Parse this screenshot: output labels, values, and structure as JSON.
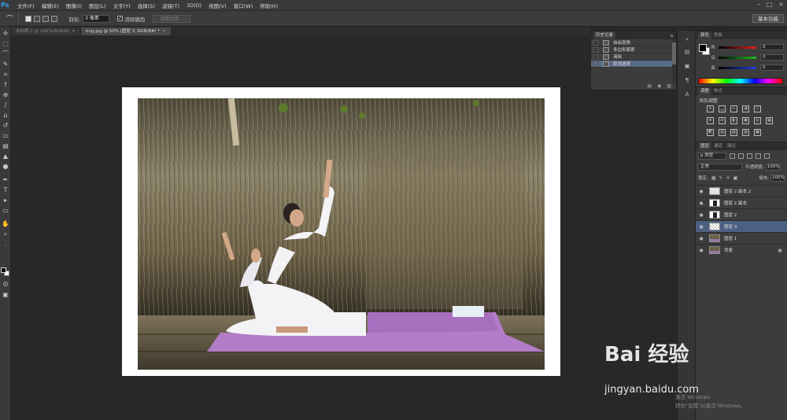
{
  "app": {
    "logo": "Ps"
  },
  "menu": [
    "文件(F)",
    "编辑(E)",
    "图像(I)",
    "图层(L)",
    "文字(Y)",
    "选择(S)",
    "滤镜(T)",
    "3D(D)",
    "视图(V)",
    "窗口(W)",
    "帮助(H)"
  ],
  "window_controls": [
    "–",
    "□",
    "×"
  ],
  "options": {
    "tool_icon": "lasso-icon",
    "feather_label": "羽化:",
    "feather_value": "0 像素",
    "antialias_label": "消除锯齿",
    "antialias_checked": true,
    "refine_edge": "调整边缘...",
    "workspace": "基本功能"
  },
  "tabs": [
    {
      "label": "未标题-1 @ 100%(RGB/8)",
      "active": false
    },
    {
      "label": "ting.jpg @ 50% (图层 3, RGB/8#) *",
      "active": true
    }
  ],
  "history": {
    "tabs": [
      "历史记录"
    ],
    "menu": "≡",
    "items": [
      {
        "label": "自由变换",
        "selected": false
      },
      {
        "label": "多边形套索",
        "selected": false
      },
      {
        "label": "清除",
        "selected": false
      },
      {
        "label": "取消选择",
        "selected": true
      }
    ]
  },
  "color_panel": {
    "tabs": [
      "颜色",
      "色板"
    ],
    "channels": [
      {
        "letter": "R",
        "value": "0",
        "color": "#e02020"
      },
      {
        "letter": "G",
        "value": "0",
        "color": "#20c020"
      },
      {
        "letter": "B",
        "value": "0",
        "color": "#2040e0"
      }
    ]
  },
  "adjustments": {
    "tabs": [
      "调整",
      "样式"
    ],
    "title": "添加调整"
  },
  "layers_panel": {
    "tabs": [
      "图层",
      "通道",
      "路径"
    ],
    "kind": "p 类型",
    "blend": "正常",
    "opacity_label": "不透明度:",
    "opacity": "100%",
    "lock_label": "锁定:",
    "fill_label": "填充:",
    "fill": "100%",
    "layers": [
      {
        "name": "图层 2 副本 2",
        "thumb": "transparent",
        "selected": false,
        "locked": false
      },
      {
        "name": "图层 2 副本",
        "thumb": "mask",
        "selected": false,
        "locked": false
      },
      {
        "name": "图层 2",
        "thumb": "mask",
        "selected": false,
        "locked": false
      },
      {
        "name": "图层 3",
        "thumb": "transparent",
        "selected": true,
        "locked": false
      },
      {
        "name": "图层 1",
        "thumb": "photo",
        "selected": false,
        "locked": false
      },
      {
        "name": "背景",
        "thumb": "photo",
        "selected": false,
        "locked": true
      }
    ]
  },
  "watermark": {
    "logo": "Bai 经验",
    "url": "jingyan.baidu.com"
  },
  "activation_notice": [
    "激活 Windows",
    "转到\"设置\"以激活 Windows。"
  ]
}
